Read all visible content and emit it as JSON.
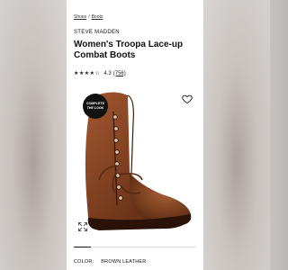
{
  "breadcrumb": {
    "items": [
      "Shoes",
      "Boots"
    ],
    "separator": "/"
  },
  "product": {
    "brand": "STEVE MADDEN",
    "title": "Women's Troopa Lace-up Combat Boots",
    "rating": {
      "stars": "★★★★☆",
      "value": "4.3",
      "review_count": "(756)"
    }
  },
  "badge": {
    "line1": "COMPLETE",
    "line2": "THE LOOK"
  },
  "gallery": {
    "progress_fraction": 0.14
  },
  "color": {
    "label": "COLOR:",
    "value": "BROWN LEATHER"
  },
  "icons": {
    "favorite": "heart-icon",
    "expand": "expand-icon"
  },
  "colors": {
    "boot": "#7a3d1f",
    "badge": "#111111",
    "panel": "#ffffff"
  }
}
